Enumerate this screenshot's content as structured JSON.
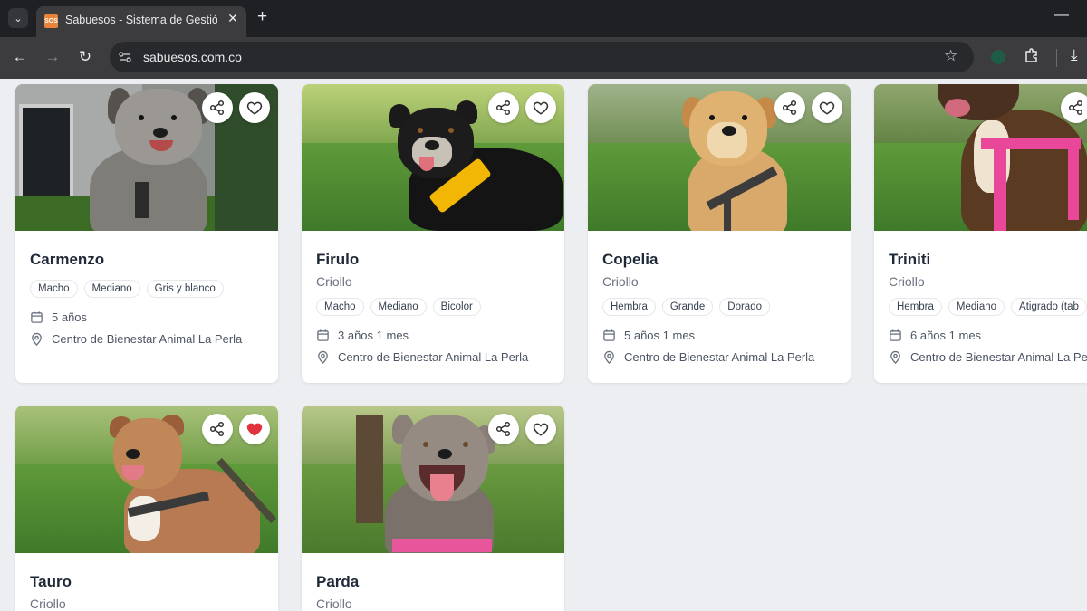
{
  "browser": {
    "tab_title": "Sabuesos - Sistema de Gestión",
    "favicon_text": "SOS",
    "url": "sabuesos.com.co",
    "icons": [
      "tab-search-icon",
      "close-icon",
      "new-tab-icon",
      "minimize-icon",
      "back-icon",
      "forward-icon",
      "reload-icon",
      "site-info-icon",
      "bookmark-star-icon",
      "extension-icon",
      "puzzle-icon",
      "download-icon"
    ]
  },
  "colors": {
    "favorite_active": "#e0333d",
    "card_bg": "#ffffff",
    "page_bg": "#eceef2"
  },
  "cards": [
    {
      "name": "Carmenzo",
      "breed": "",
      "tags": [
        "Macho",
        "Mediano",
        "Gris y blanco"
      ],
      "age": "5 años",
      "location": "Centro de Bienestar Animal La Perla",
      "favorite": false
    },
    {
      "name": "Firulo",
      "breed": "Criollo",
      "tags": [
        "Macho",
        "Mediano",
        "Bicolor"
      ],
      "age": "3 años 1 mes",
      "location": "Centro de Bienestar Animal La Perla",
      "favorite": false
    },
    {
      "name": "Copelia",
      "breed": "Criollo",
      "tags": [
        "Hembra",
        "Grande",
        "Dorado"
      ],
      "age": "5 años 1 mes",
      "location": "Centro de Bienestar Animal La Perla",
      "favorite": false
    },
    {
      "name": "Triniti",
      "breed": "Criollo",
      "tags": [
        "Hembra",
        "Mediano",
        "Atigrado (tab"
      ],
      "age": "6 años 1 mes",
      "location": "Centro de Bienestar Animal La Pe",
      "favorite": false
    },
    {
      "name": "Tauro",
      "breed": "Criollo",
      "tags": [],
      "age": "",
      "location": "",
      "favorite": true
    },
    {
      "name": "Parda",
      "breed": "Criollo",
      "tags": [],
      "age": "",
      "location": "",
      "favorite": false
    }
  ]
}
